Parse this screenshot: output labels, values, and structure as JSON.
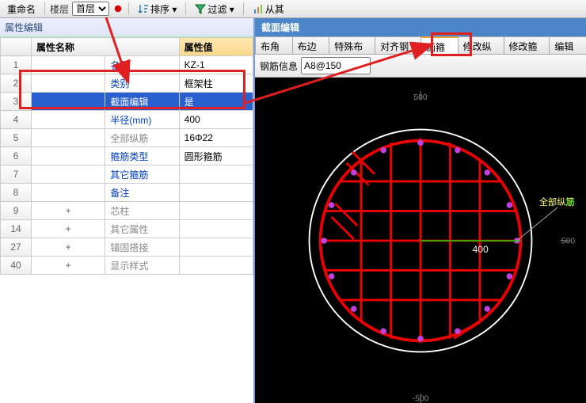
{
  "topbar": {
    "rename_label": "重命名",
    "floor_label": "楼层",
    "floor_selected": "首层",
    "sort_label": "排序 ▾",
    "filter_label": "过滤 ▾",
    "tools_label": "从其"
  },
  "left_panel": {
    "title": "属性编辑",
    "col_name": "属性名称",
    "col_value": "属性值",
    "rows": [
      {
        "n": "1",
        "name": "名称",
        "value": "KZ-1",
        "cls": "name"
      },
      {
        "n": "2",
        "name": "类别",
        "value": "框架柱",
        "cls": "name"
      },
      {
        "n": "3",
        "name": "截面编辑",
        "value": "是",
        "cls": "name",
        "selected": true
      },
      {
        "n": "4",
        "name": "半径(mm)",
        "value": "400",
        "cls": "name"
      },
      {
        "n": "5",
        "name": "全部纵筋",
        "value": "16Φ22",
        "cls": "gray"
      },
      {
        "n": "6",
        "name": "箍筋类型",
        "value": "圆形箍筋",
        "cls": "name"
      },
      {
        "n": "7",
        "name": "其它箍筋",
        "value": "",
        "cls": "name"
      },
      {
        "n": "8",
        "name": "备注",
        "value": "",
        "cls": "name"
      },
      {
        "n": "9",
        "name": "芯柱",
        "value": "",
        "cls": "gray",
        "expand": "+"
      },
      {
        "n": "14",
        "name": "其它属性",
        "value": "",
        "cls": "gray",
        "expand": "+"
      },
      {
        "n": "27",
        "name": "锚固搭接",
        "value": "",
        "cls": "gray",
        "expand": "+"
      },
      {
        "n": "40",
        "name": "显示样式",
        "value": "",
        "cls": "gray",
        "expand": "+"
      }
    ]
  },
  "right_panel": {
    "title": "截面编辑",
    "tabs": [
      "布角筋",
      "布边筋",
      "特殊布筋",
      "对齐钢筋",
      "画箍筋",
      "修改纵筋",
      "修改箍筋",
      "编辑节"
    ],
    "active_tab": 4,
    "rebar_info_label": "钢筋信息",
    "rebar_info_value": "A8@150"
  },
  "canvas": {
    "radius_label": "400",
    "ticks": [
      "500",
      "-500",
      "500",
      "-500"
    ],
    "annotation_label": "全部纵筋",
    "annotation_value": "16"
  }
}
